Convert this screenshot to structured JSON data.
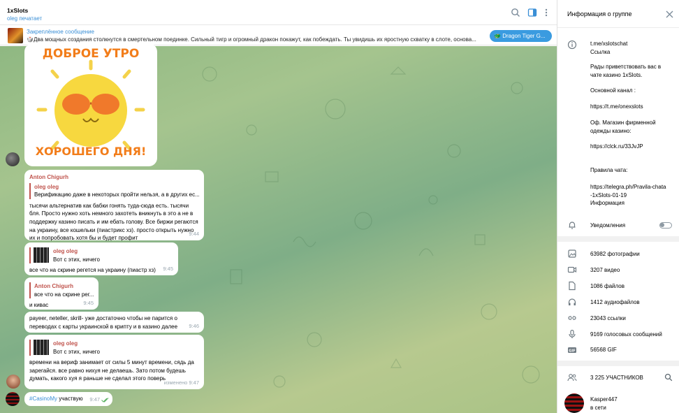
{
  "header": {
    "title": "1xSlots",
    "status": "oleg печатает"
  },
  "pinned": {
    "title": "Закреплённое сообщение",
    "text": "Два мощных создания столкнутся в смертельном поединке. Сильный тигр и огромный дракон покажут, как побеждать. Ты увидишь их яростную схватку в слоте, основа...",
    "button": "Dragon Tiger G..."
  },
  "sticker": {
    "top": "ДОБРОЕ УТРО",
    "bottom": "ХОРОШЕГО ДНЯ!"
  },
  "messages": [
    {
      "author": "Anton Chigurh",
      "reply_name": "oleg oleg",
      "reply_text": "Верификацию даже в некоторых пройти нельзя, а в других ес...",
      "text": "тысячи альтернатив как бабки гонять туда-сюда есть. тысячи бля. Просто нужно хоть немного захотеть вникнуть в это а не в поддержку казино писать и им ебать голову. Все биржи регаются на украину, все кошельки (пиастрикс хз). просто открыть нужно их и попробовать хотя бы и будет профит",
      "time": "9:44"
    },
    {
      "reply_name": "oleg oleg",
      "reply_text": "Вот с этих, ничего",
      "text": "все что на скрине регется на украину (пиастр хз)",
      "time": "9:45"
    },
    {
      "reply_name": "Anton Chigurh",
      "reply_text": "все что на скрине рег...",
      "text": "и кивас",
      "time": "9:45"
    },
    {
      "text": "payeer, neteller, skrill- уже достаточно чтобы не парится о переводах с карты украинской в крипту и в казино далее",
      "time": "9:46"
    },
    {
      "reply_name": "oleg oleg",
      "reply_text": "Вот с этих, ничего",
      "text": "времени на вериф занимает от силы 5 минут времени, сядь да зарегайся. все равно нихуя не делаешь. Зато потом будешь думать, какого хуя я раньше не сделал этого поверь",
      "time": "изменено 9:47"
    },
    {
      "hashtag": "#CasinoMy",
      "text": " участвую",
      "time": "9:47"
    }
  ],
  "info": {
    "title": "Информация о группе",
    "link": "t.me/xslotschat",
    "link_label": "Ссылка",
    "desc1": "Рады приветствовать вас в чате казино 1xSlots.",
    "desc2": "Основной канал :",
    "desc3": "https://t.me/onexslots",
    "desc4": "Оф. Магазин фирменной одежды казино:",
    "desc5": "https://clck.ru/33JvJP",
    "desc6": "Правила чата:",
    "desc7": "https://telegra.ph/Pravila-chata-1xSlots-01-19",
    "desc_label": "Информация",
    "notifications": "Уведомления",
    "media": [
      "63982 фотографии",
      "3207 видео",
      "1086 файлов",
      "1412 аудиофайлов",
      "23043 ссылки",
      "9169 голосовых сообщений",
      "56568 GIF"
    ],
    "members": "3 225 УЧАСТНИКОВ",
    "member_name": "Kasper447",
    "member_status": "в сети"
  },
  "colors": {
    "accent": "#3a8fd6",
    "author": "#c0544d",
    "bg": "#a5c48e"
  }
}
